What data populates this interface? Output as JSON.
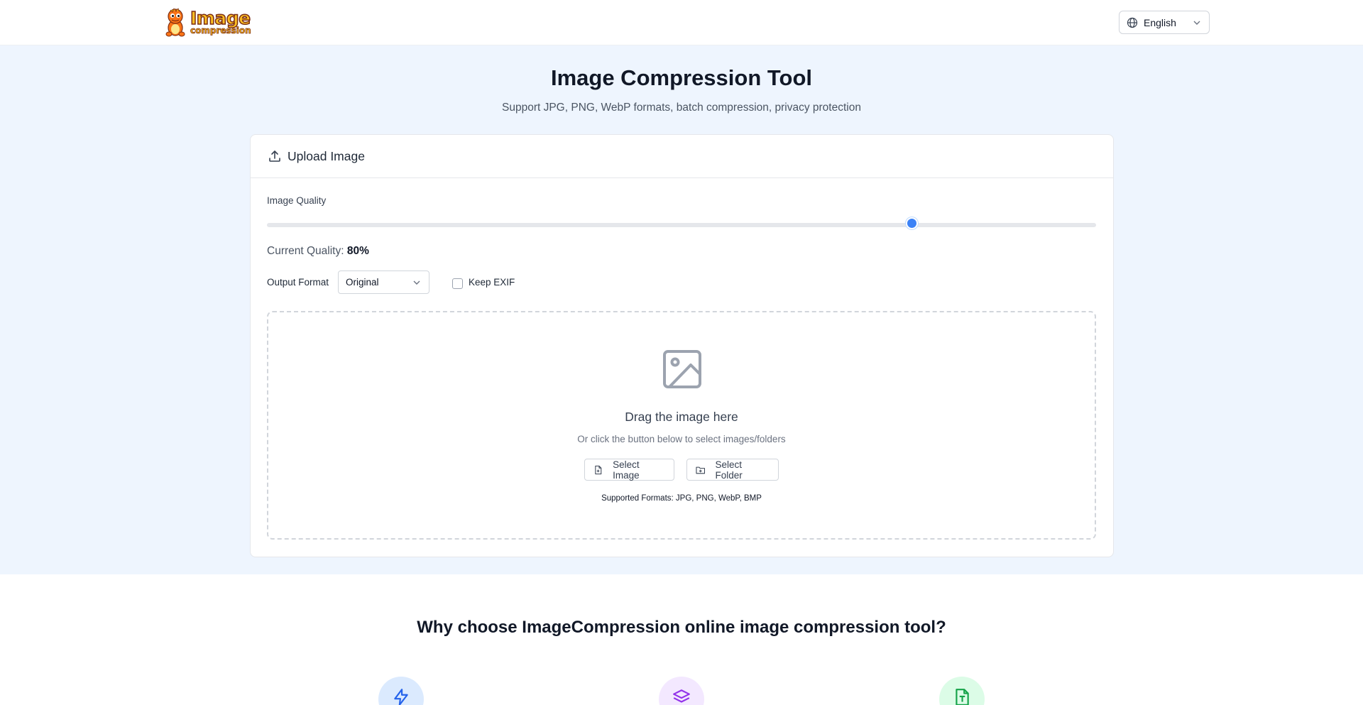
{
  "header": {
    "logo_line1": "Image",
    "logo_line2": "compression",
    "language": "English"
  },
  "hero": {
    "title": "Image Compression Tool",
    "subtitle": "Support JPG, PNG, WebP formats, batch compression, privacy protection"
  },
  "upload_card": {
    "heading": "Upload Image",
    "quality_label": "Image Quality",
    "quality_value": 80,
    "current_quality_label": "Current Quality:",
    "current_quality_text": "80%",
    "output_format_label": "Output Format",
    "output_format_value": "Original",
    "keep_exif_label": "Keep EXIF",
    "keep_exif_checked": false,
    "dropzone": {
      "title": "Drag the image here",
      "subtitle": "Or click the button below to select images/folders",
      "select_image_label": "Select Image",
      "select_folder_label": "Select Folder",
      "supported_formats": "Supported Formats: JPG, PNG, WebP, BMP"
    }
  },
  "features": {
    "heading": "Why choose ImageCompression online image compression tool?",
    "icons": [
      "lightning-icon",
      "layers-icon",
      "file-text-icon"
    ]
  },
  "colors": {
    "accent": "#3b82f6",
    "hero_bg": "#eef5fe"
  }
}
